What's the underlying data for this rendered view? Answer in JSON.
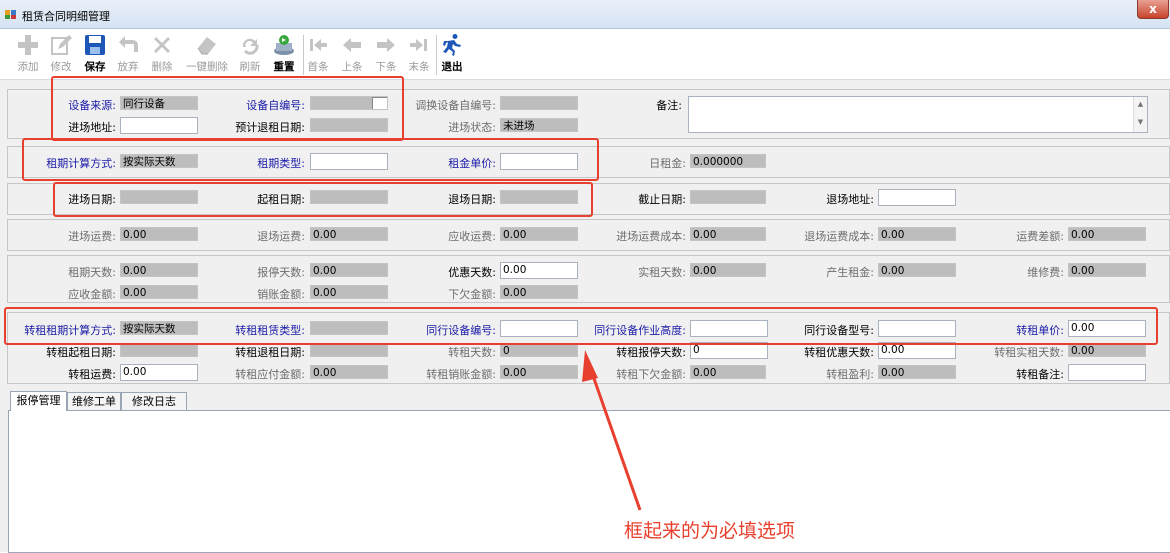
{
  "window": {
    "title": "租赁合同明细管理",
    "close_label": "x"
  },
  "toolbar": {
    "add": "添加",
    "edit": "修改",
    "save": "保存",
    "undo": "放弃",
    "delete": "删除",
    "delete_all": "一键删除",
    "refresh": "刷新",
    "reset": "重置",
    "first": "首条",
    "prev": "上条",
    "next": "下条",
    "last": "末条",
    "exit": "退出"
  },
  "section1": {
    "source_label": "设备来源:",
    "source_value": "同行设备",
    "selfno_label": "设备自编号:",
    "selfno_value": "",
    "swapno_label": "调换设备自编号:",
    "swapno_value": "",
    "remark_label": "备注:",
    "remark_value": "",
    "entry_addr_label": "进场地址:",
    "entry_addr_value": "",
    "return_date_label": "预计退租日期:",
    "return_date_value": "",
    "entry_status_label": "进场状态:",
    "entry_status_value": "未进场"
  },
  "section2": {
    "calc_label": "租期计算方式:",
    "calc_value": "按实际天数",
    "type_label": "租期类型:",
    "type_value": "",
    "price_label": "租金单价:",
    "price_value": "",
    "daily_label": "日租金:",
    "daily_value": "0.000000"
  },
  "section3": {
    "entry_date_label": "进场日期:",
    "entry_date_value": "",
    "start_date_label": "起租日期:",
    "start_date_value": "",
    "exit_date_label": "退场日期:",
    "exit_date_value": "",
    "end_date_label": "截止日期:",
    "end_date_value": "",
    "exit_addr_label": "退场地址:",
    "exit_addr_value": ""
  },
  "section4": {
    "entry_fee_label": "进场运费:",
    "entry_fee_value": "0.00",
    "exit_fee_label": "退场运费:",
    "exit_fee_value": "0.00",
    "recv_fee_label": "应收运费:",
    "recv_fee_value": "0.00",
    "entry_cost_label": "进场运费成本:",
    "entry_cost_value": "0.00",
    "exit_cost_label": "退场运费成本:",
    "exit_cost_value": "0.00",
    "diff_label": "运费差额:",
    "diff_value": "0.00"
  },
  "section5": {
    "days_label": "租期天数:",
    "days_value": "0.00",
    "stop_label": "报停天数:",
    "stop_value": "0.00",
    "discount_label": "优惠天数:",
    "discount_value": "0.00",
    "actual_label": "实租天数:",
    "actual_value": "0.00",
    "rent_label": "产生租金:",
    "rent_value": "0.00",
    "repair_label": "维修费:",
    "repair_value": "0.00",
    "recv_amt_label": "应收金额:",
    "recv_amt_value": "0.00",
    "writeoff_label": "销账金额:",
    "writeoff_value": "0.00",
    "owe_label": "下欠金额:",
    "owe_value": "0.00"
  },
  "section6": {
    "sub_calc_label": "转租租期计算方式:",
    "sub_calc_value": "按实际天数",
    "sub_type_label": "转租租赁类型:",
    "sub_type_value": "",
    "peer_no_label": "同行设备编号:",
    "peer_no_value": "",
    "peer_height_label": "同行设备作业高度:",
    "peer_height_value": "",
    "peer_model_label": "同行设备型号:",
    "peer_model_value": "",
    "sub_price_label": "转租单价:",
    "sub_price_value": "0.00",
    "sub_start_label": "转租起租日期:",
    "sub_start_value": "",
    "sub_return_label": "转租退租日期:",
    "sub_return_value": "",
    "sub_days_label": "转租天数:",
    "sub_days_value": "0",
    "sub_stop_label": "转租报停天数:",
    "sub_stop_value": "0",
    "sub_discount_label": "转租优惠天数:",
    "sub_discount_value": "0.00",
    "sub_actual_label": "转租实租天数:",
    "sub_actual_value": "0.00",
    "sub_fee_label": "转租运费:",
    "sub_fee_value": "0.00",
    "sub_payable_label": "转租应付金额:",
    "sub_payable_value": "0.00",
    "sub_writeoff_label": "转租销账金额:",
    "sub_writeoff_value": "0.00",
    "sub_owe_label": "转租下欠金额:",
    "sub_owe_value": "0.00",
    "sub_profit_label": "转租盈利:",
    "sub_profit_value": "0.00",
    "sub_remark_label": "转租备注:",
    "sub_remark_value": ""
  },
  "tabs": [
    "报停管理",
    "维修工单",
    "修改日志"
  ],
  "annotation": "框起来的为必填选项",
  "colors": {
    "required_label": "#1a1aa8",
    "annotation": "#e8402e",
    "readonly_field": "#bdbdbd"
  }
}
